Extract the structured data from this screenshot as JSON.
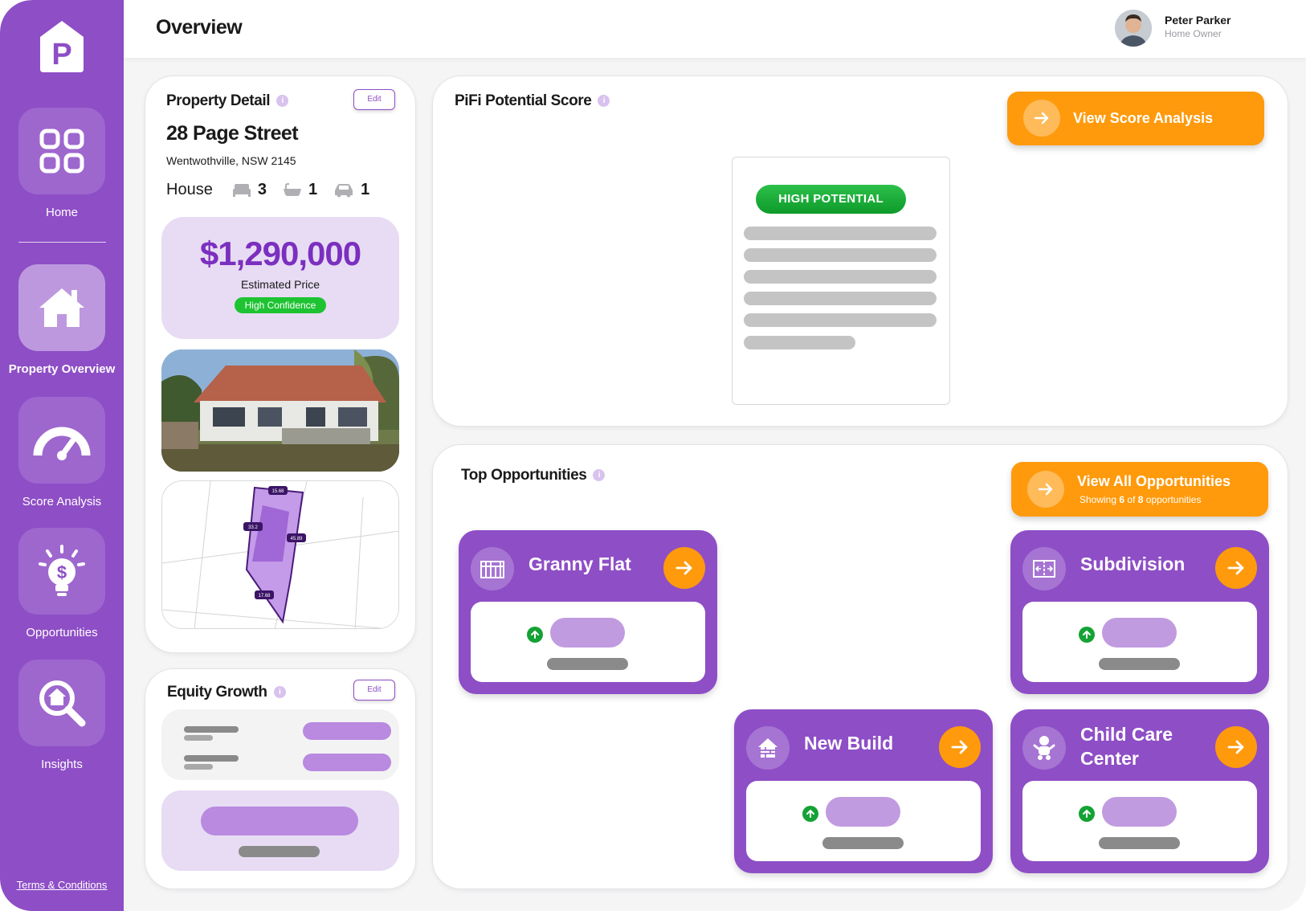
{
  "header": {
    "title": "Overview"
  },
  "user": {
    "name": "Peter Parker",
    "role": "Home Owner"
  },
  "sidebar": {
    "logo_letter": "P",
    "items": [
      {
        "label": "Home",
        "icon": "grid-icon"
      },
      {
        "label": "Property Overview",
        "icon": "house-icon"
      },
      {
        "label": "Score Analysis",
        "icon": "gauge-icon"
      },
      {
        "label": "Opportunities",
        "icon": "lightbulb-dollar-icon"
      },
      {
        "label": "Insights",
        "icon": "house-magnifier-icon"
      }
    ],
    "terms": "Terms & Conditions"
  },
  "property": {
    "title": "Property Detail",
    "edit_label": "Edit",
    "street": "28 Page Street",
    "suburb": "Wentwothville, NSW 2145",
    "type": "House",
    "bedrooms": "3",
    "bathrooms": "1",
    "parking": "1",
    "price": "$1,290,000",
    "price_label": "Estimated Price",
    "confidence": "High Confidence",
    "map_labels": {
      "top": "15.68",
      "left": "33.2",
      "right": "45.89",
      "bottom": "17.68"
    }
  },
  "equity": {
    "title": "Equity Growth",
    "edit_label": "Edit"
  },
  "score": {
    "title": "PiFi Potential Score",
    "button_label": "View Score Analysis",
    "badge": "HIGH POTENTIAL"
  },
  "opportunities": {
    "title": "Top Opportunities",
    "button_label": "View All Opportunities",
    "showing_prefix": "Showing ",
    "showing_count": "6",
    "showing_of": " of ",
    "showing_total": "8",
    "showing_suffix": " opportunities",
    "cards": [
      {
        "title": "Granny Flat",
        "icon": "granny-flat-icon"
      },
      {
        "title": "Subdivision",
        "icon": "subdivision-icon"
      },
      {
        "title": "New Build",
        "icon": "new-build-icon"
      },
      {
        "title": "Child Care Center",
        "icon": "child-care-icon"
      }
    ]
  },
  "colors": {
    "primary": "#8e4ec6",
    "accent": "#ff9a0c",
    "success": "#1ec332",
    "price": "#7b2fbf"
  }
}
